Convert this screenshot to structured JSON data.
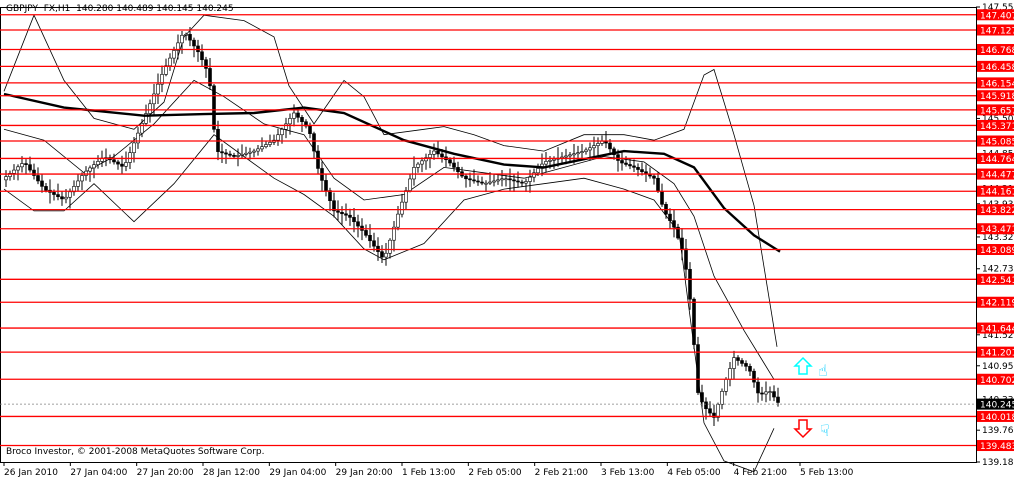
{
  "header": {
    "symbol": "GBPJPY",
    "timeframe": "FX,H1",
    "ohlc": "140.280 140.489 140.145 140.245"
  },
  "copyright": "Broco Investor, © 2001-2008 MetaQuotes Software Corp.",
  "colors": {
    "level_line": "#ff0000",
    "level_label_bg": "#ff0000",
    "candles": "#000000",
    "up_arrow": "#00ffff",
    "down_arrow": "#ff0000",
    "hand_icon": "#00ccff"
  },
  "icons": [
    "up-arrow-icon",
    "down-arrow-icon",
    "thumbs-up-icon",
    "thumbs-down-icon"
  ],
  "chart_data": {
    "type": "candlestick",
    "symbol": "GBPJPY",
    "ylim": [
      139.18,
      147.55
    ],
    "y_ticks": [
      "147.550",
      "146.790",
      "146.145",
      "145.500",
      "144.855",
      "144.210",
      "143.930",
      "143.320",
      "142.735",
      "142.120",
      "141.520",
      "140.950",
      "140.330",
      "139.765",
      "139.180"
    ],
    "x_ticks": [
      "26 Jan 2010",
      "27 Jan 04:00",
      "27 Jan 20:00",
      "28 Jan 12:00",
      "29 Jan 04:00",
      "29 Jan 20:00",
      "1 Feb 13:00",
      "2 Feb 05:00",
      "2 Feb 21:00",
      "3 Feb 13:00",
      "4 Feb 05:00",
      "4 Feb 21:00",
      "5 Feb 13:00"
    ],
    "levels": [
      "147.407",
      "147.127",
      "146.768",
      "146.458",
      "146.154",
      "145.918",
      "145.657",
      "145.371",
      "145.085",
      "144.764",
      "144.477",
      "144.161",
      "143.822",
      "143.471",
      "143.089",
      "142.541",
      "142.119",
      "141.644",
      "141.201",
      "140.702",
      "140.018",
      "139.483"
    ],
    "current_price": "140.245",
    "ma_line": [
      [
        0,
        145.95
      ],
      [
        60,
        145.7
      ],
      [
        140,
        145.55
      ],
      [
        200,
        145.58
      ],
      [
        250,
        145.6
      ],
      [
        300,
        145.7
      ],
      [
        340,
        145.6
      ],
      [
        400,
        145.1
      ],
      [
        450,
        144.85
      ],
      [
        500,
        144.65
      ],
      [
        540,
        144.6
      ],
      [
        580,
        144.75
      ],
      [
        620,
        144.9
      ],
      [
        660,
        144.85
      ],
      [
        690,
        144.6
      ],
      [
        720,
        143.85
      ],
      [
        750,
        143.35
      ],
      [
        776,
        143.05
      ]
    ],
    "bb_upper": [
      [
        0,
        146.0
      ],
      [
        30,
        147.4
      ],
      [
        60,
        146.2
      ],
      [
        90,
        145.5
      ],
      [
        130,
        145.3
      ],
      [
        160,
        145.8
      ],
      [
        180,
        147.0
      ],
      [
        200,
        147.4
      ],
      [
        240,
        147.3
      ],
      [
        270,
        147.0
      ],
      [
        285,
        146.1
      ],
      [
        310,
        145.4
      ],
      [
        340,
        146.2
      ],
      [
        360,
        145.9
      ],
      [
        380,
        145.2
      ],
      [
        420,
        145.3
      ],
      [
        440,
        145.35
      ],
      [
        470,
        145.2
      ],
      [
        500,
        145.0
      ],
      [
        540,
        144.9
      ],
      [
        580,
        145.2
      ],
      [
        620,
        145.2
      ],
      [
        650,
        145.1
      ],
      [
        680,
        145.3
      ],
      [
        700,
        146.3
      ],
      [
        710,
        146.4
      ],
      [
        730,
        145.2
      ],
      [
        750,
        143.9
      ],
      [
        773,
        141.3
      ]
    ],
    "bb_middle": [
      [
        0,
        145.3
      ],
      [
        40,
        145.1
      ],
      [
        80,
        144.5
      ],
      [
        110,
        144.8
      ],
      [
        150,
        145.4
      ],
      [
        190,
        146.2
      ],
      [
        220,
        145.9
      ],
      [
        260,
        145.4
      ],
      [
        300,
        145.2
      ],
      [
        330,
        144.4
      ],
      [
        360,
        144.0
      ],
      [
        400,
        144.1
      ],
      [
        440,
        144.6
      ],
      [
        480,
        144.5
      ],
      [
        520,
        144.4
      ],
      [
        560,
        144.6
      ],
      [
        600,
        144.8
      ],
      [
        640,
        144.7
      ],
      [
        670,
        144.3
      ],
      [
        690,
        143.7
      ],
      [
        710,
        142.6
      ],
      [
        740,
        141.6
      ],
      [
        770,
        140.7
      ]
    ],
    "bb_lower": [
      [
        0,
        144.2
      ],
      [
        30,
        143.8
      ],
      [
        60,
        143.8
      ],
      [
        90,
        144.3
      ],
      [
        130,
        143.6
      ],
      [
        170,
        144.3
      ],
      [
        210,
        145.2
      ],
      [
        240,
        144.8
      ],
      [
        270,
        144.4
      ],
      [
        300,
        144.1
      ],
      [
        330,
        143.7
      ],
      [
        360,
        143.1
      ],
      [
        380,
        142.9
      ],
      [
        420,
        143.2
      ],
      [
        460,
        144.0
      ],
      [
        500,
        144.2
      ],
      [
        540,
        144.3
      ],
      [
        580,
        144.4
      ],
      [
        620,
        144.2
      ],
      [
        650,
        144.0
      ],
      [
        675,
        143.4
      ],
      [
        690,
        141.3
      ],
      [
        700,
        139.9
      ],
      [
        720,
        139.2
      ],
      [
        750,
        139.0
      ],
      [
        770,
        139.8
      ]
    ],
    "price_path": [
      [
        0,
        144.4
      ],
      [
        20,
        144.7
      ],
      [
        40,
        144.2
      ],
      [
        60,
        144.0
      ],
      [
        80,
        144.5
      ],
      [
        100,
        144.8
      ],
      [
        120,
        144.6
      ],
      [
        140,
        145.5
      ],
      [
        160,
        146.4
      ],
      [
        180,
        147.1
      ],
      [
        195,
        146.7
      ],
      [
        205,
        146.3
      ],
      [
        212,
        144.9
      ],
      [
        230,
        144.8
      ],
      [
        250,
        144.9
      ],
      [
        270,
        145.1
      ],
      [
        290,
        145.6
      ],
      [
        305,
        145.3
      ],
      [
        315,
        144.5
      ],
      [
        330,
        143.8
      ],
      [
        345,
        143.7
      ],
      [
        360,
        143.4
      ],
      [
        380,
        142.9
      ],
      [
        395,
        143.8
      ],
      [
        410,
        144.6
      ],
      [
        430,
        144.9
      ],
      [
        445,
        144.7
      ],
      [
        460,
        144.4
      ],
      [
        480,
        144.3
      ],
      [
        500,
        144.4
      ],
      [
        520,
        144.3
      ],
      [
        540,
        144.7
      ],
      [
        560,
        144.8
      ],
      [
        580,
        144.9
      ],
      [
        600,
        145.1
      ],
      [
        615,
        144.7
      ],
      [
        630,
        144.6
      ],
      [
        650,
        144.4
      ],
      [
        660,
        143.8
      ],
      [
        670,
        143.5
      ],
      [
        680,
        143.0
      ],
      [
        688,
        141.9
      ],
      [
        693,
        140.5
      ],
      [
        700,
        140.2
      ],
      [
        710,
        140.0
      ],
      [
        720,
        140.6
      ],
      [
        730,
        141.1
      ],
      [
        745,
        140.9
      ],
      [
        755,
        140.4
      ],
      [
        765,
        140.5
      ],
      [
        775,
        140.25
      ]
    ]
  }
}
